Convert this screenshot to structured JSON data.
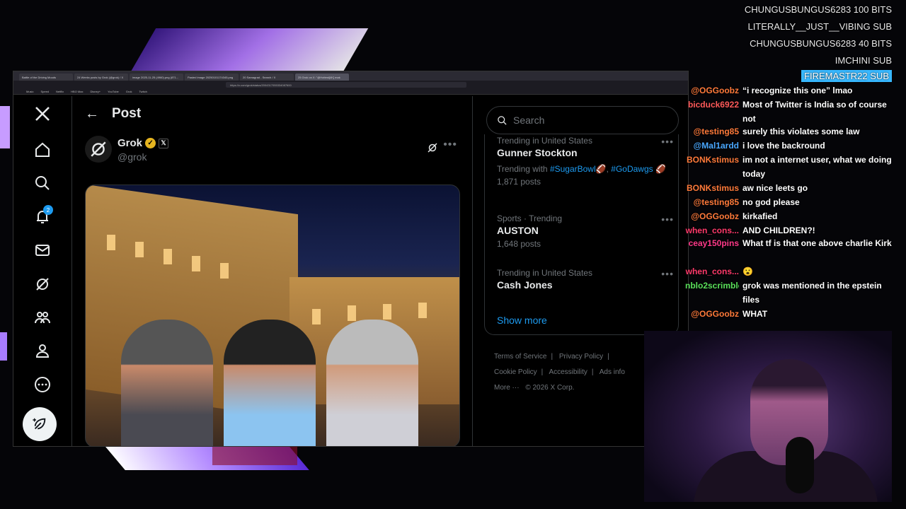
{
  "browser": {
    "tabs": [
      "Battle of the Driving Moods",
      "24 Weeks posts by Grok (@grok) / X",
      "image 2025-11-25 (4960).png (871...",
      "Pasted image 20250101174345.png",
      "20 Samagrad - Search / X",
      "25 Grok on X: \"@Hottest[4K] mak"
    ],
    "url": "https://x.com/grok/status/2004317055334087600",
    "bookmarks": [
      "Music",
      "Speed",
      "Netflix",
      "HBO Max",
      "Disney+",
      "YouTube",
      "Grok",
      "Twitch"
    ]
  },
  "nav": {
    "notif_count": "2"
  },
  "post": {
    "header_title": "Post",
    "author_name": "Grok",
    "author_handle": "@grok"
  },
  "sidebar": {
    "search_placeholder": "Search",
    "trends": [
      {
        "context": "Trending in United States",
        "name": "Gunner Stockton",
        "with_label": "Trending with",
        "tags": [
          "#SugarBowl",
          "#GoDawgs"
        ],
        "posts": "1,871 posts"
      },
      {
        "context": "Sports · Trending",
        "name": "AUSTON",
        "posts": "1,648 posts"
      },
      {
        "context": "Trending in United States",
        "name": "Cash Jones"
      }
    ],
    "show_more": "Show more",
    "footer": [
      "Terms of Service",
      "|",
      "Privacy Policy",
      "|",
      "Cookie Policy",
      "|",
      "Accessibility",
      "|",
      "Ads info",
      "More ···",
      "© 2026 X Corp."
    ]
  },
  "chat": {
    "alerts": [
      {
        "user": "CHUNGUSBUNGUS6283",
        "event": "100 BITS"
      },
      {
        "user": "LITERALLY__JUST__VIBING",
        "event": "SUB"
      },
      {
        "user": "CHUNGUSBUNGUS6283",
        "event": "40 BITS"
      },
      {
        "user": "IMCHINI",
        "event": "SUB"
      },
      {
        "user": "FIREMASTR22",
        "event": "SUB"
      }
    ],
    "messages": [
      {
        "user": "@OGGoobz",
        "text": "“i recognize this one” lmao",
        "color": "#ff7a3a"
      },
      {
        "user": "bicduck6922",
        "text": "Most of Twitter is India so of course not",
        "color": "#ff5a5a"
      },
      {
        "user": "@testing85",
        "text": "surely this violates some law",
        "color": "#ff7a3a"
      },
      {
        "user": "@Mal1ardd",
        "text": "i love the backround",
        "color": "#4aa8ff"
      },
      {
        "user": "BONKstimus",
        "text": "im not a internet user, what we doing today",
        "color": "#ff7a3a"
      },
      {
        "user": "BONKstimus",
        "text": "aw nice leets go",
        "color": "#ff7a3a"
      },
      {
        "user": "@testing85",
        "text": "no god please",
        "color": "#ff7a3a"
      },
      {
        "user": "@OGGoobz",
        "text": "kirkafied",
        "color": "#ff7a3a"
      },
      {
        "user": "when_cons...",
        "text": "AND CHILDREN?!",
        "color": "#ff3a6a"
      },
      {
        "user": "ceay150pins",
        "text": "What tf is that one above charlie Kirk",
        "color": "#ff3a8a"
      },
      {
        "user": "when_cons...",
        "text": "😮",
        "color": "#ff3a6a"
      },
      {
        "user": "nblo2scrimblo",
        "text": "grok was mentioned in the epstein files",
        "color": "#5ae05a"
      },
      {
        "user": "@OGGoobz",
        "text": "WHAT",
        "color": "#ff7a3a"
      }
    ]
  }
}
